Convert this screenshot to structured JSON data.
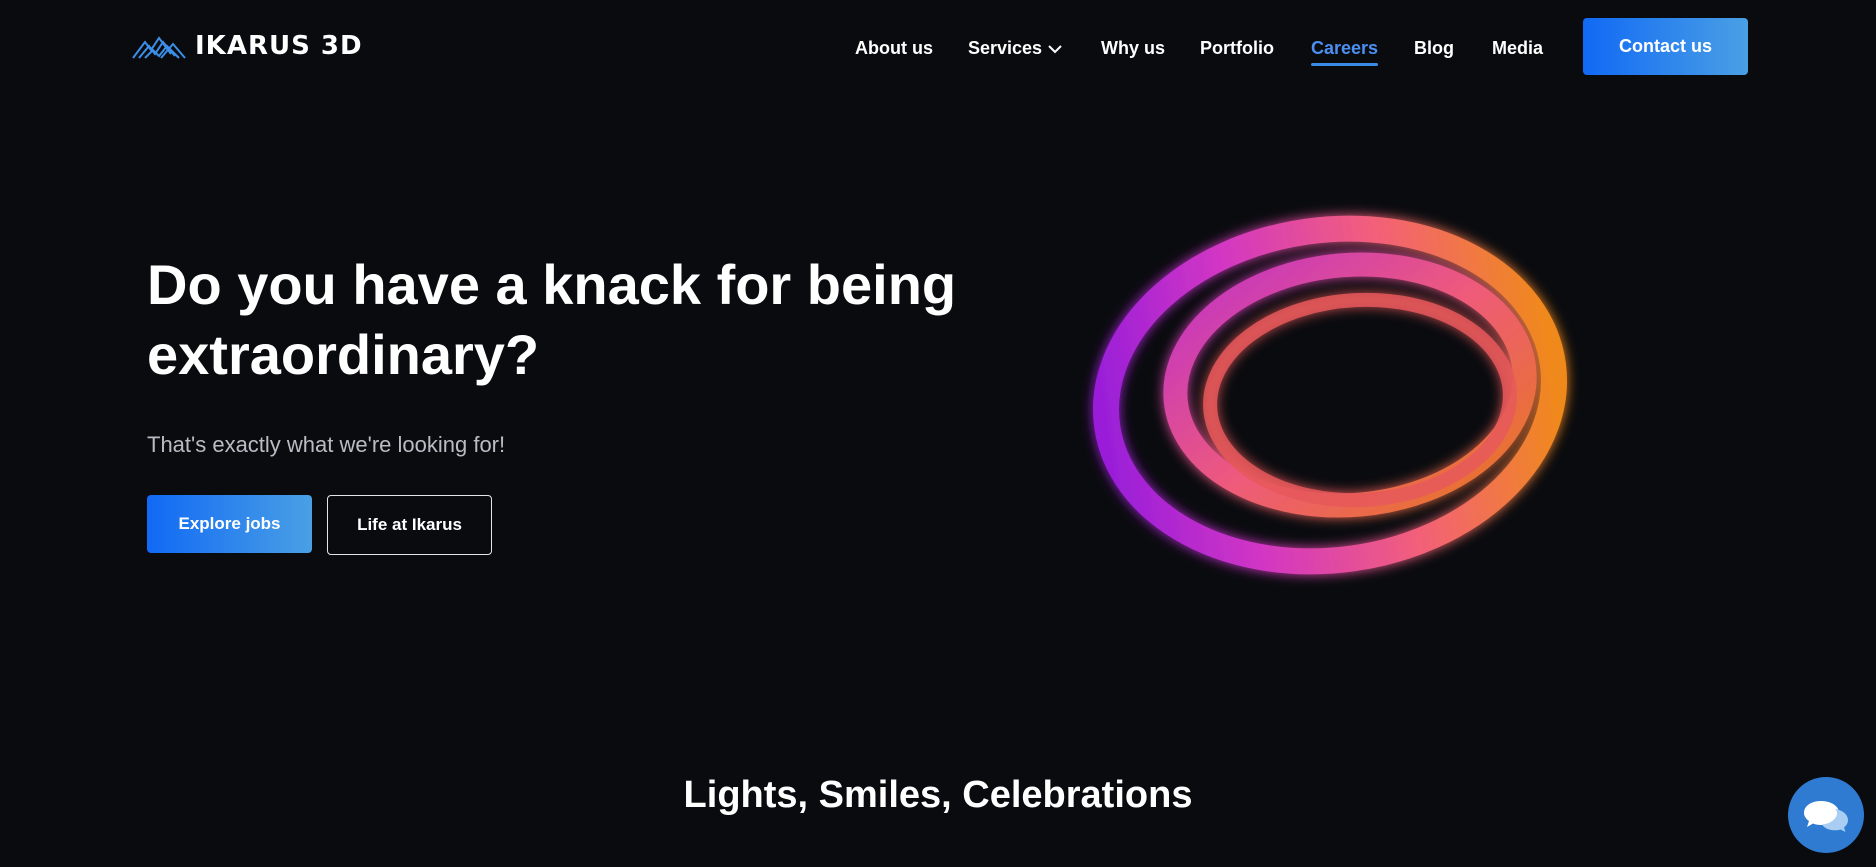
{
  "header": {
    "logo_text": "IKARUS 3D",
    "nav": {
      "about": "About us",
      "services": "Services",
      "why": "Why us",
      "portfolio": "Portfolio",
      "careers": "Careers",
      "blog": "Blog",
      "media": "Media"
    },
    "active_item": "Careers",
    "contact_label": "Contact us"
  },
  "hero": {
    "title_line1": "Do you have a knack for being",
    "title_line2": "extraordinary?",
    "subtitle": "That's exactly what we're looking for!",
    "primary_button": "Explore jobs",
    "secondary_button": "Life at Ikarus"
  },
  "section": {
    "title": "Lights, Smiles, Celebrations"
  },
  "icons": {
    "logo": "ikarus-mountain-logo-icon",
    "services_dropdown": "chevron-down-icon",
    "chat": "chat-bubbles-icon",
    "hero_art": "neon-rings-icon"
  },
  "colors": {
    "background": "#0a0b0f",
    "accent_start": "#1169f5",
    "accent_end": "#4aa0e4",
    "active_nav": "#4b8ff0",
    "chat_button": "#2e7bd1"
  }
}
